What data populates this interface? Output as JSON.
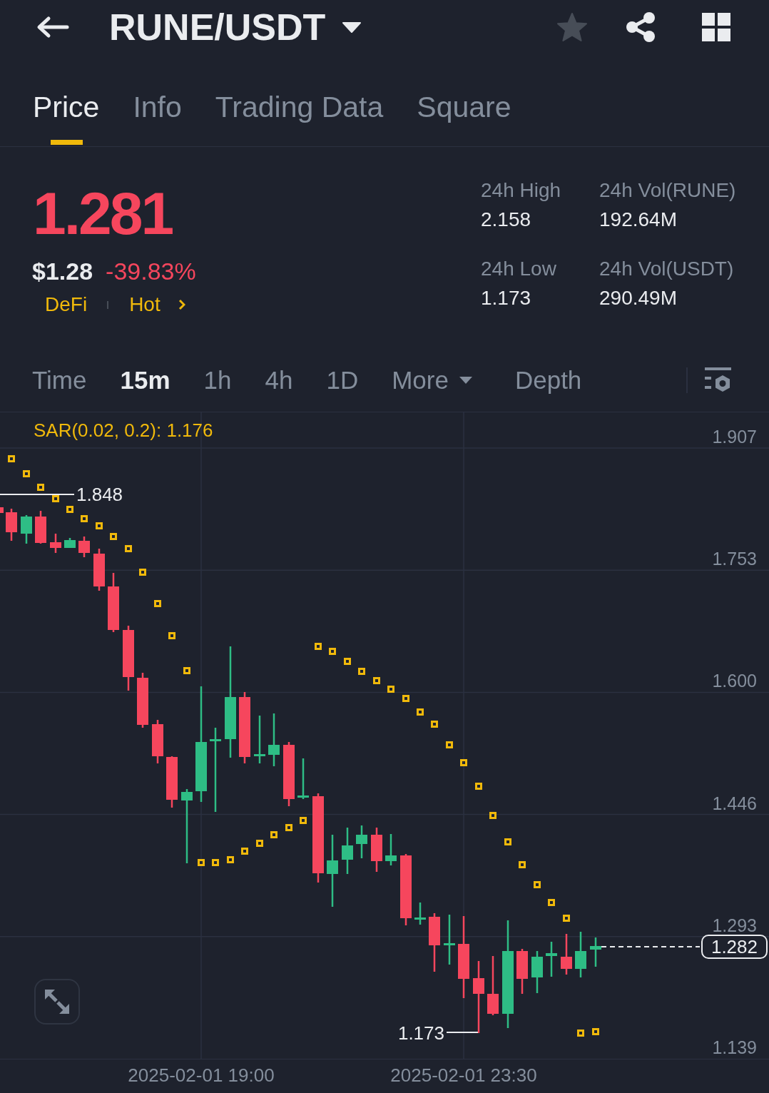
{
  "header": {
    "title": "RUNE/USDT",
    "favorite": false
  },
  "tabs": [
    {
      "label": "Price",
      "selected": true
    },
    {
      "label": "Info",
      "selected": false
    },
    {
      "label": "Trading Data",
      "selected": false
    },
    {
      "label": "Square",
      "selected": false
    }
  ],
  "ticker": {
    "price": "1.281",
    "price_down": true,
    "fiat_price": "$1.28",
    "change": "-39.83%",
    "tags": [
      "DeFi",
      "Hot"
    ],
    "stats": [
      {
        "label": "24h High",
        "value": "2.158"
      },
      {
        "label": "24h Vol(RUNE)",
        "value": "192.64M"
      },
      {
        "label": "24h Low",
        "value": "1.173"
      },
      {
        "label": "24h Vol(USDT)",
        "value": "290.49M"
      }
    ]
  },
  "intervals": [
    {
      "label": "Time",
      "kind": "interval",
      "selected": false
    },
    {
      "label": "15m",
      "kind": "interval",
      "selected": true
    },
    {
      "label": "1h",
      "kind": "interval",
      "selected": false
    },
    {
      "label": "4h",
      "kind": "interval",
      "selected": false
    },
    {
      "label": "1D",
      "kind": "interval",
      "selected": false
    },
    {
      "label": "More",
      "kind": "menu",
      "selected": false
    },
    {
      "label": "Depth",
      "kind": "view",
      "selected": false
    }
  ],
  "chart": {
    "indicator": "SAR(0.02, 0.2): 1.176",
    "y_labels": [
      "1.907",
      "1.753",
      "1.600",
      "1.446",
      "1.293",
      "1.139"
    ],
    "x_labels": [
      "2025-02-01 19:00",
      "2025-02-01 23:30"
    ],
    "high_label": "1.848",
    "low_label": "1.173",
    "last_price": "1.282"
  }
}
